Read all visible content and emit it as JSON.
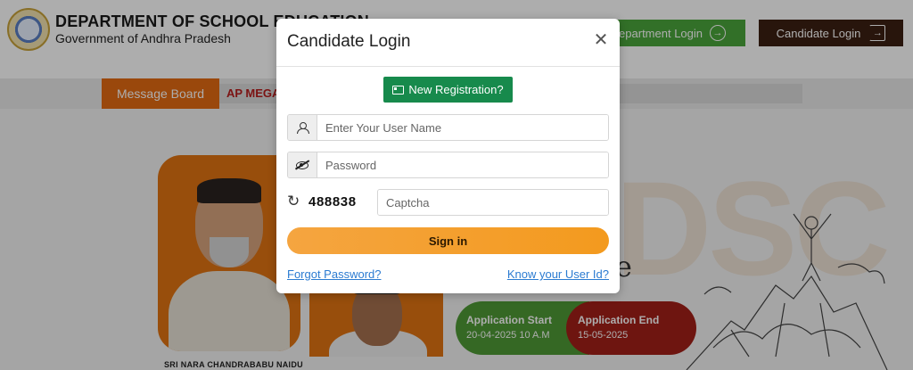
{
  "header": {
    "title": "DEPARTMENT OF SCHOOL EDUCATION",
    "subtitle": "Government of Andhra Pradesh",
    "department_login": "Department Login",
    "candidate_login": "Candidate Login"
  },
  "ticker": {
    "message_board": "Message Board",
    "text": "AP MEGA D"
  },
  "hero": {
    "leader_name": "SRI NARA CHANDRABABU NAIDU",
    "bg_text": "DSC",
    "script_letter": "e",
    "app_start_title": "Application Start",
    "app_start_date": "20-04-2025 10 A.M",
    "app_end_title": "Application End",
    "app_end_date": "15-05-2025"
  },
  "modal": {
    "title": "Candidate Login",
    "close_symbol": "✕",
    "new_registration": "New Registration?",
    "username_placeholder": "Enter Your User Name",
    "password_placeholder": "Password",
    "captcha_code": "488838",
    "captcha_placeholder": "Captcha",
    "signin": "Sign in",
    "forgot_password": "Forgot Password?",
    "know_user_id": "Know your User Id?"
  },
  "colors": {
    "dept_button": "#4aa63b",
    "candidate_button": "#3b1f12",
    "message_board": "#e36a12",
    "new_registration": "#178a4c",
    "signin": "#f39a1e",
    "link": "#2b7bd1",
    "app_start": "#4e9a35",
    "app_end": "#a32019"
  }
}
